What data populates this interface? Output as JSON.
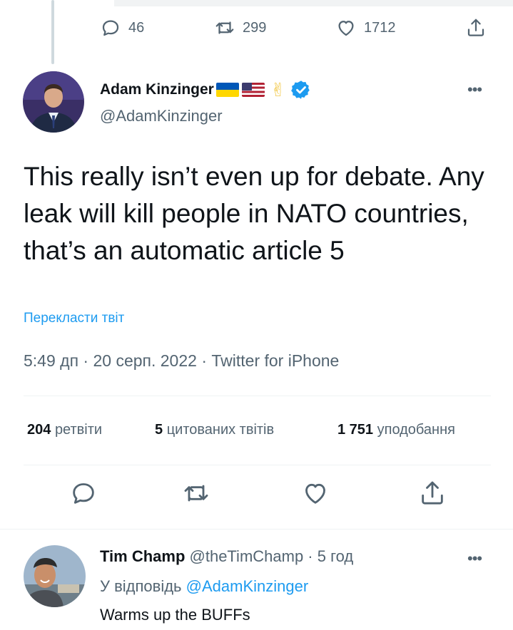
{
  "parent_actions": {
    "replies": "46",
    "retweets": "299",
    "likes": "1712"
  },
  "author": {
    "name": "Adam Kinzinger",
    "handle": "@AdamKinzinger",
    "victory_emoji": "✌"
  },
  "tweet": {
    "text": "This really isn’t even up for debate. Any leak will kill people in NATO countries, that’s an automatic article 5",
    "translate_label": "Перекласти твіт",
    "meta": "5:49 дп · 20 серп. 2022 · Twitter for iPhone"
  },
  "stats": {
    "retweets_count": "204",
    "retweets_label": "ретвіти",
    "quotes_count": "5",
    "quotes_label": "цитованих твітів",
    "likes_count": "1 751",
    "likes_label": "уподобання"
  },
  "more_label": "•••",
  "reply": {
    "name": "Tim Champ",
    "handle_time": "@theTimChamp · 5 год",
    "replying_prefix": "У відповідь",
    "replying_to": "@AdamKinzinger",
    "text": "Warms up the BUFFs"
  },
  "colors": {
    "accent": "#1d9bf0",
    "muted": "#536471",
    "text": "#0f1419",
    "ua_blue": "#0057b7",
    "ua_yellow": "#ffd700"
  },
  "icons": [
    "reply-icon",
    "retweet-icon",
    "like-icon",
    "share-icon",
    "verified-badge-icon",
    "more-icon"
  ]
}
